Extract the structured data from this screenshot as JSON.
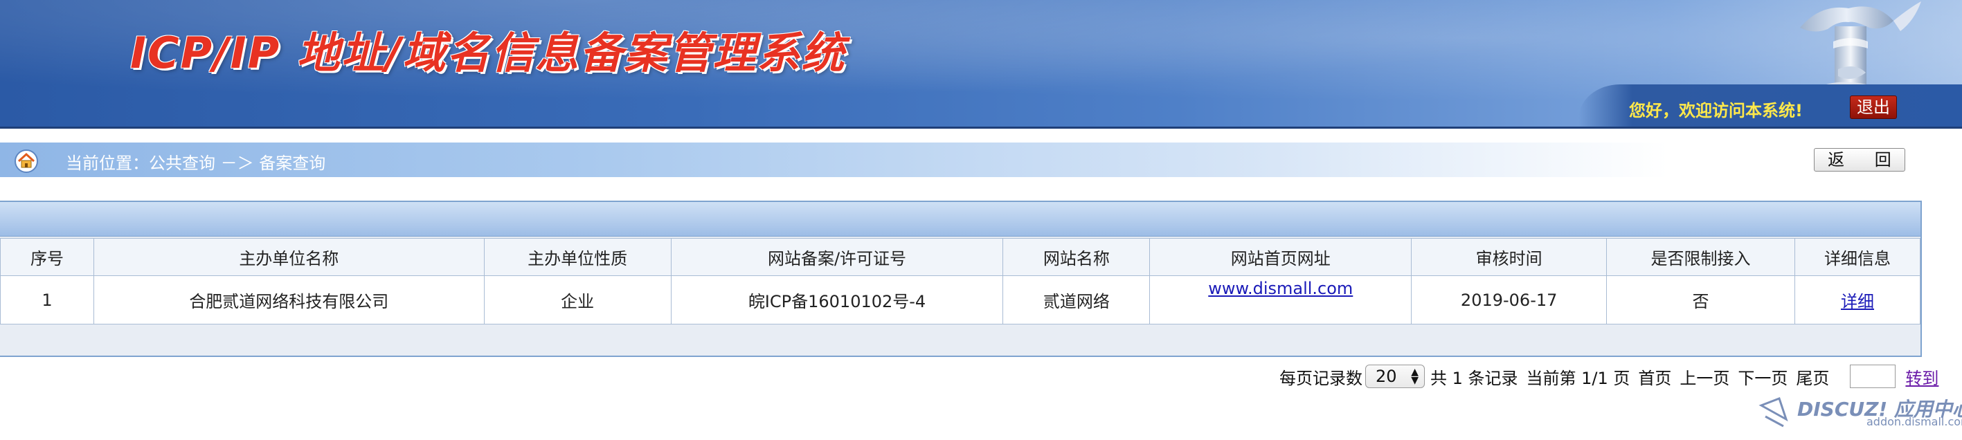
{
  "header": {
    "title": "ICP/IP 地址/域名信息备案管理系统",
    "welcome": "您好，欢迎访问本系统!",
    "logout_label": "退出"
  },
  "breadcrumb": {
    "text": "当前位置：公共查询  －＞  备案查询",
    "back_label": "返 回"
  },
  "table": {
    "columns": [
      "序号",
      "主办单位名称",
      "主办单位性质",
      "网站备案/许可证号",
      "网站名称",
      "网站首页网址",
      "审核时间",
      "是否限制接入",
      "详细信息"
    ],
    "rows": [
      [
        "1",
        "合肥贰道网络科技有限公司",
        "企业",
        "皖ICP备16010102号-4",
        "贰道网络",
        "www.dismall.com",
        "2019-06-17",
        "否",
        "详细"
      ]
    ]
  },
  "pager": {
    "per_page_label": "每页记录数",
    "per_page_value": "20",
    "total": "共 1 条记录",
    "current": "当前第 1/1 页",
    "first": "首页",
    "prev": "上一页",
    "next": "下一页",
    "last": "尾页",
    "goto": "转到"
  },
  "watermark": {
    "brand": "DISCUZ! 应用中心",
    "url": "addon.dismall.com"
  },
  "colors": {
    "header_blue": "#2b5aa6",
    "title_red": "#e83222",
    "welcome_yellow": "#ffe84a",
    "logout_red": "#c52a1a",
    "link_blue": "#1a1ab8"
  }
}
